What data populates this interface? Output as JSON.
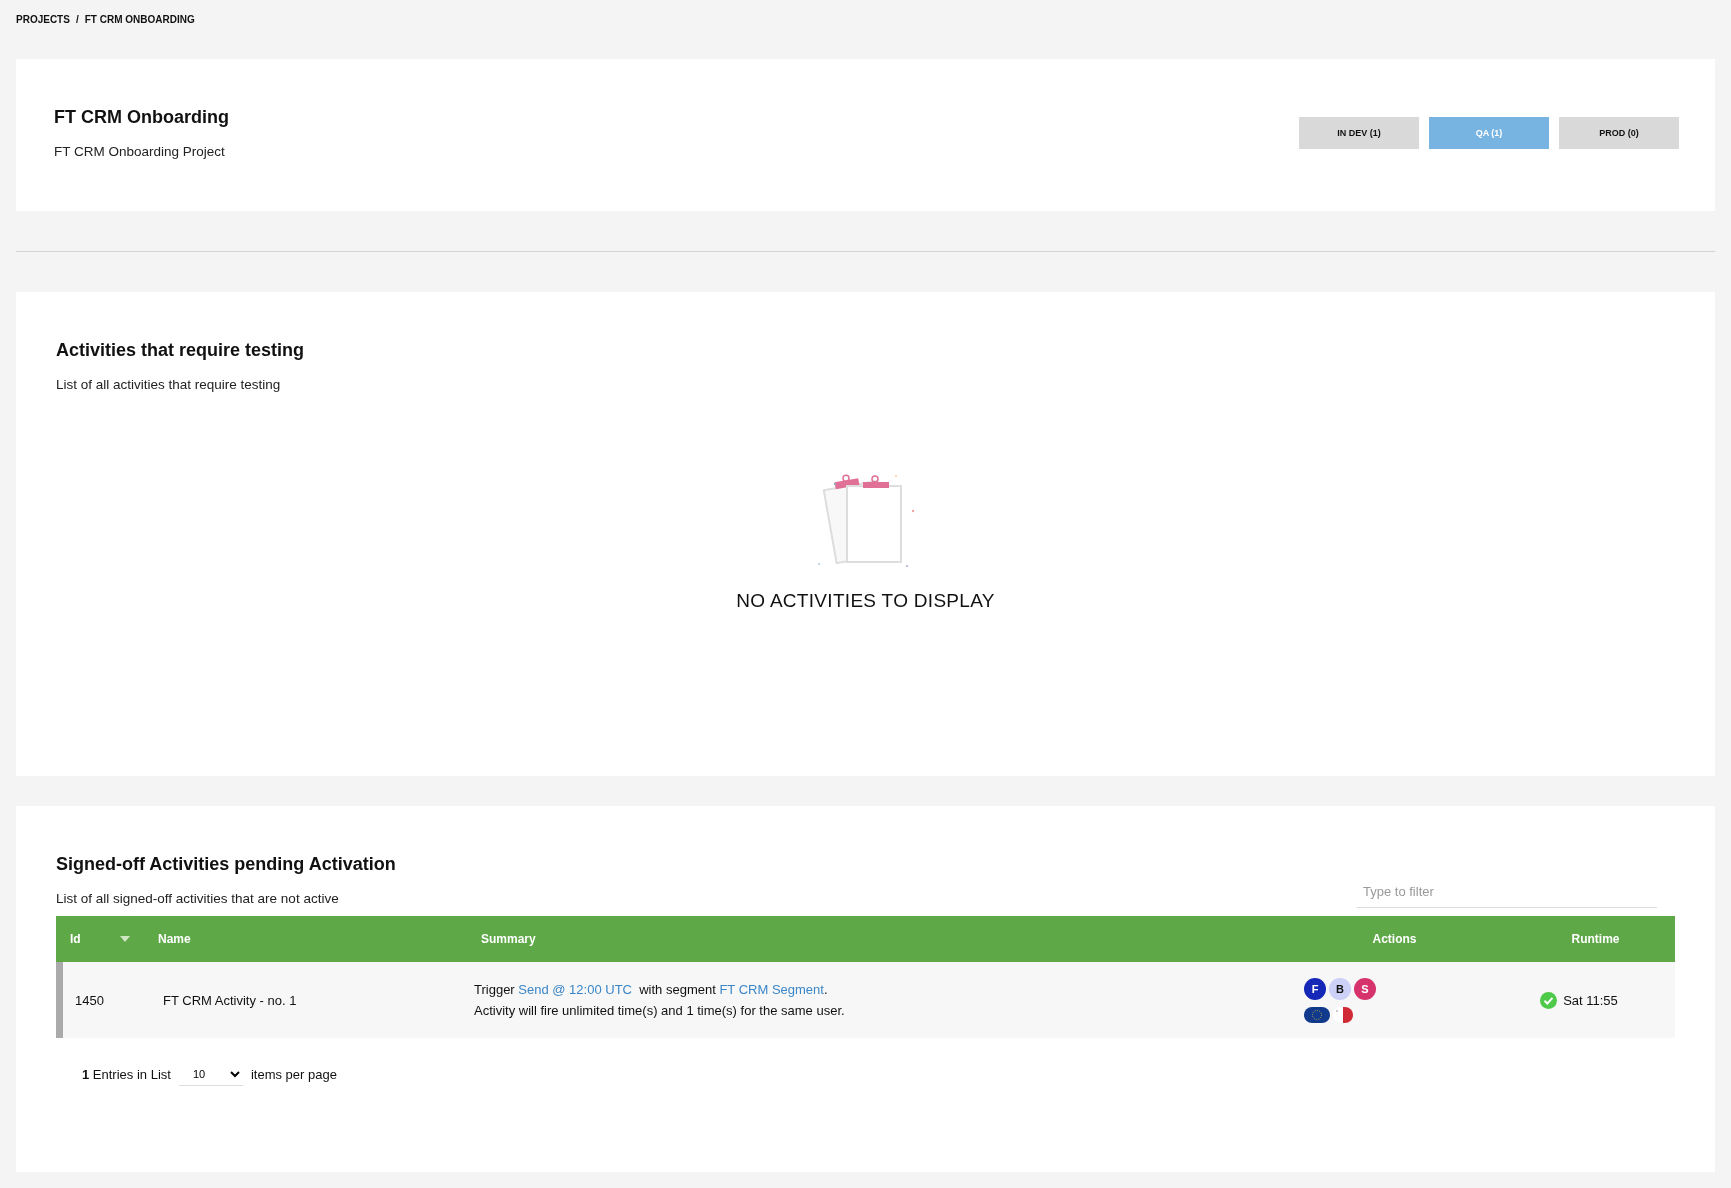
{
  "breadcrumb": {
    "items": [
      "PROJECTS",
      "FT CRM ONBOARDING"
    ],
    "separator": "/"
  },
  "project": {
    "title": "FT CRM Onboarding",
    "subtitle": "FT CRM Onboarding Project"
  },
  "stages": [
    {
      "label": "IN DEV (1)",
      "selected": false
    },
    {
      "label": "QA (1)",
      "selected": true
    },
    {
      "label": "PROD (0)",
      "selected": false
    }
  ],
  "testing": {
    "title": "Activities that require testing",
    "subtitle": "List of all activities that require testing",
    "empty_text": "NO ACTIVITIES TO DISPLAY"
  },
  "pending": {
    "title": "Signed-off Activities pending Activation",
    "subtitle": "List of all signed-off activities that are not active",
    "filter": {
      "placeholder": "Type to filter"
    },
    "columns": [
      {
        "label": "Id",
        "sorted": true
      },
      {
        "label": "Name",
        "sorted": false
      },
      {
        "label": "Summary",
        "sorted": false
      },
      {
        "label": "Actions",
        "sorted": false
      },
      {
        "label": "Runtime",
        "sorted": false
      }
    ],
    "rows": [
      {
        "id": "1450",
        "name": "FT CRM Activity - no. 1",
        "summary_line_1": [
          {
            "kind": "text",
            "text": "Trigger "
          },
          {
            "kind": "link",
            "text": "Send @ 12:00 UTC"
          },
          {
            "kind": "text",
            "text": "  with segment "
          },
          {
            "kind": "link",
            "text": "FT CRM Segment"
          },
          {
            "kind": "text",
            "text": "."
          }
        ],
        "summary_line_2": "Activity will fire unlimited time(s) and 1 time(s) for the same user.",
        "actions": [
          {
            "letter": "F",
            "color": "#1628b8"
          },
          {
            "letter": "B",
            "color": "#cdd0f7"
          },
          {
            "letter": "S",
            "color": "#d6336c"
          }
        ],
        "flags": [
          {
            "kind": "eu"
          },
          {
            "kind": "malta"
          }
        ],
        "runtime": "Sat 11:55"
      }
    ],
    "footer": {
      "count": "1",
      "count_label": "Entries in List",
      "page_size": "10",
      "page_size_label": "items per page"
    }
  }
}
